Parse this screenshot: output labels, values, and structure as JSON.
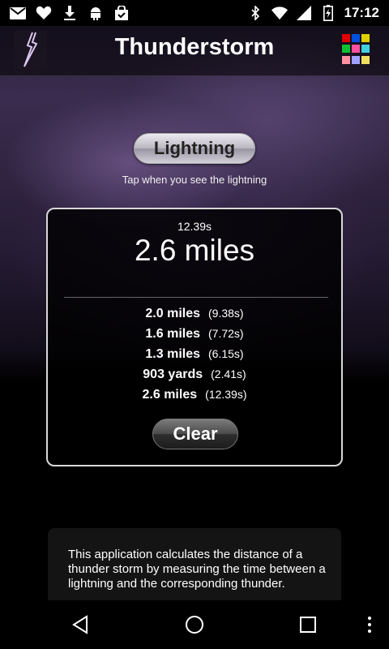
{
  "status_bar": {
    "time": "17:12",
    "left_icons": [
      "gmail-icon",
      "heart-icon",
      "download-icon",
      "android-debug-icon",
      "shopping-bag-icon"
    ],
    "right_icons": [
      "bluetooth-icon",
      "wifi-icon",
      "signal-icon",
      "battery-icon"
    ]
  },
  "action_bar": {
    "title": "Thunderstorm",
    "app_icon": "lightning-bolt-icon",
    "menu_icon": "color-grid-icon",
    "menu_colors": [
      "#e00000",
      "#0050e0",
      "#e0d000",
      "#10c030",
      "#ff4fa0",
      "#40d0e0",
      "#ff90a0",
      "#a0a0ff",
      "#f0e060"
    ]
  },
  "main": {
    "lightning_button_label": "Lightning",
    "lightning_hint": "Tap when you see the lightning",
    "last_measurement": {
      "time": "12.39s",
      "distance": "2.6 miles"
    },
    "history": [
      {
        "distance": "2.0 miles",
        "time": "(9.38s)"
      },
      {
        "distance": "1.6 miles",
        "time": "(7.72s)"
      },
      {
        "distance": "1.3 miles",
        "time": "(6.15s)"
      },
      {
        "distance": "903 yards",
        "time": "(2.41s)"
      },
      {
        "distance": "2.6 miles",
        "time": "(12.39s)"
      }
    ],
    "clear_button_label": "Clear"
  },
  "description": {
    "text": "This application calculates the distance of a thunder storm by measuring the time between a lightning and the corresponding thunder."
  },
  "nav_bar": {
    "icons": [
      "back-icon",
      "home-icon",
      "recents-icon",
      "overflow-menu-icon"
    ]
  }
}
